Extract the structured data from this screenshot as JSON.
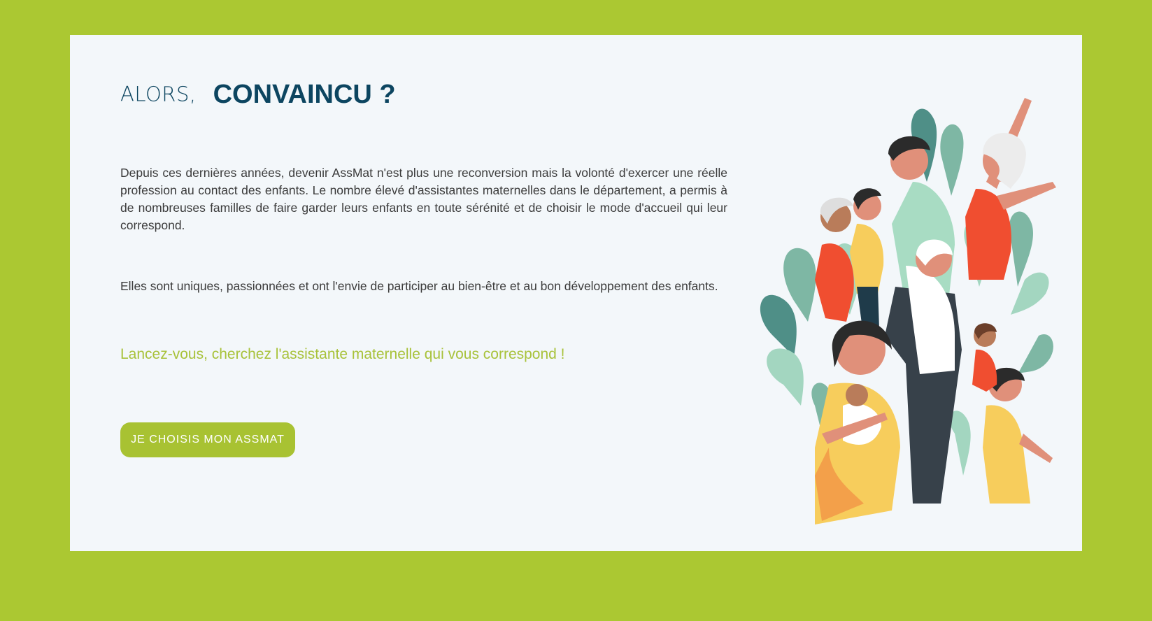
{
  "section": {
    "title_light": "ALORS,",
    "title_bold": "CONVAINCU ?",
    "paragraph_1": "Depuis ces dernières années, devenir AssMat n'est plus une reconversion mais la volonté d'exercer une réelle profession au contact des enfants. Le nombre élevé d'assistantes maternelles dans le département, a permis à de nombreuses familles de faire garder leurs enfants en toute sérénité et de choisir le mode d'accueil qui leur correspond.",
    "paragraph_2": "Elles sont uniques, passionnées et ont l'envie de participer au bien-être et au bon développement des enfants.",
    "highlight": "Lancez-vous, cherchez l'assistante maternelle qui vous correspond !",
    "button_label": "JE CHOISIS MON ASSMAT",
    "illustration_icon": "family-group-illustration"
  },
  "colors": {
    "background": "#abc832",
    "card": "#f3f7fa",
    "title": "#0c4560",
    "body_text": "#3b3b3b",
    "accent": "#a8c232",
    "button_text": "#ffffff"
  }
}
